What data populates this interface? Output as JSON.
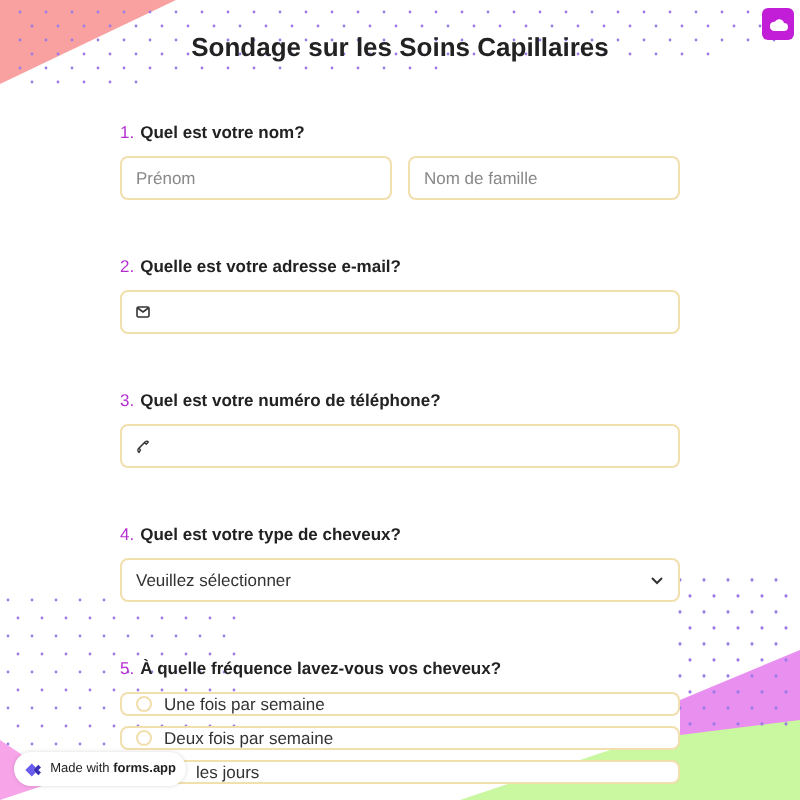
{
  "title": "Sondage sur les Soins Capillaires",
  "questions": [
    {
      "number": "1.",
      "label": "Quel est votre nom?",
      "kind": "name",
      "fields": [
        {
          "placeholder": "Prénom"
        },
        {
          "placeholder": "Nom de famille"
        }
      ]
    },
    {
      "number": "2.",
      "label": "Quelle est votre adresse e-mail?",
      "kind": "email"
    },
    {
      "number": "3.",
      "label": "Quel est votre numéro de téléphone?",
      "kind": "phone"
    },
    {
      "number": "4.",
      "label": "Quel est votre type de cheveux?",
      "kind": "select",
      "value": "Veuillez sélectionner"
    },
    {
      "number": "5.",
      "label": "À quelle fréquence lavez-vous vos cheveux?",
      "kind": "radio",
      "options": [
        {
          "label": "Une fois par semaine",
          "kind": "radio"
        },
        {
          "label": "Deux fois par semaine",
          "kind": "radio"
        },
        {
          "label": "les jours",
          "kind": "partial"
        }
      ]
    }
  ],
  "badge": "Made with **forms.app**"
}
